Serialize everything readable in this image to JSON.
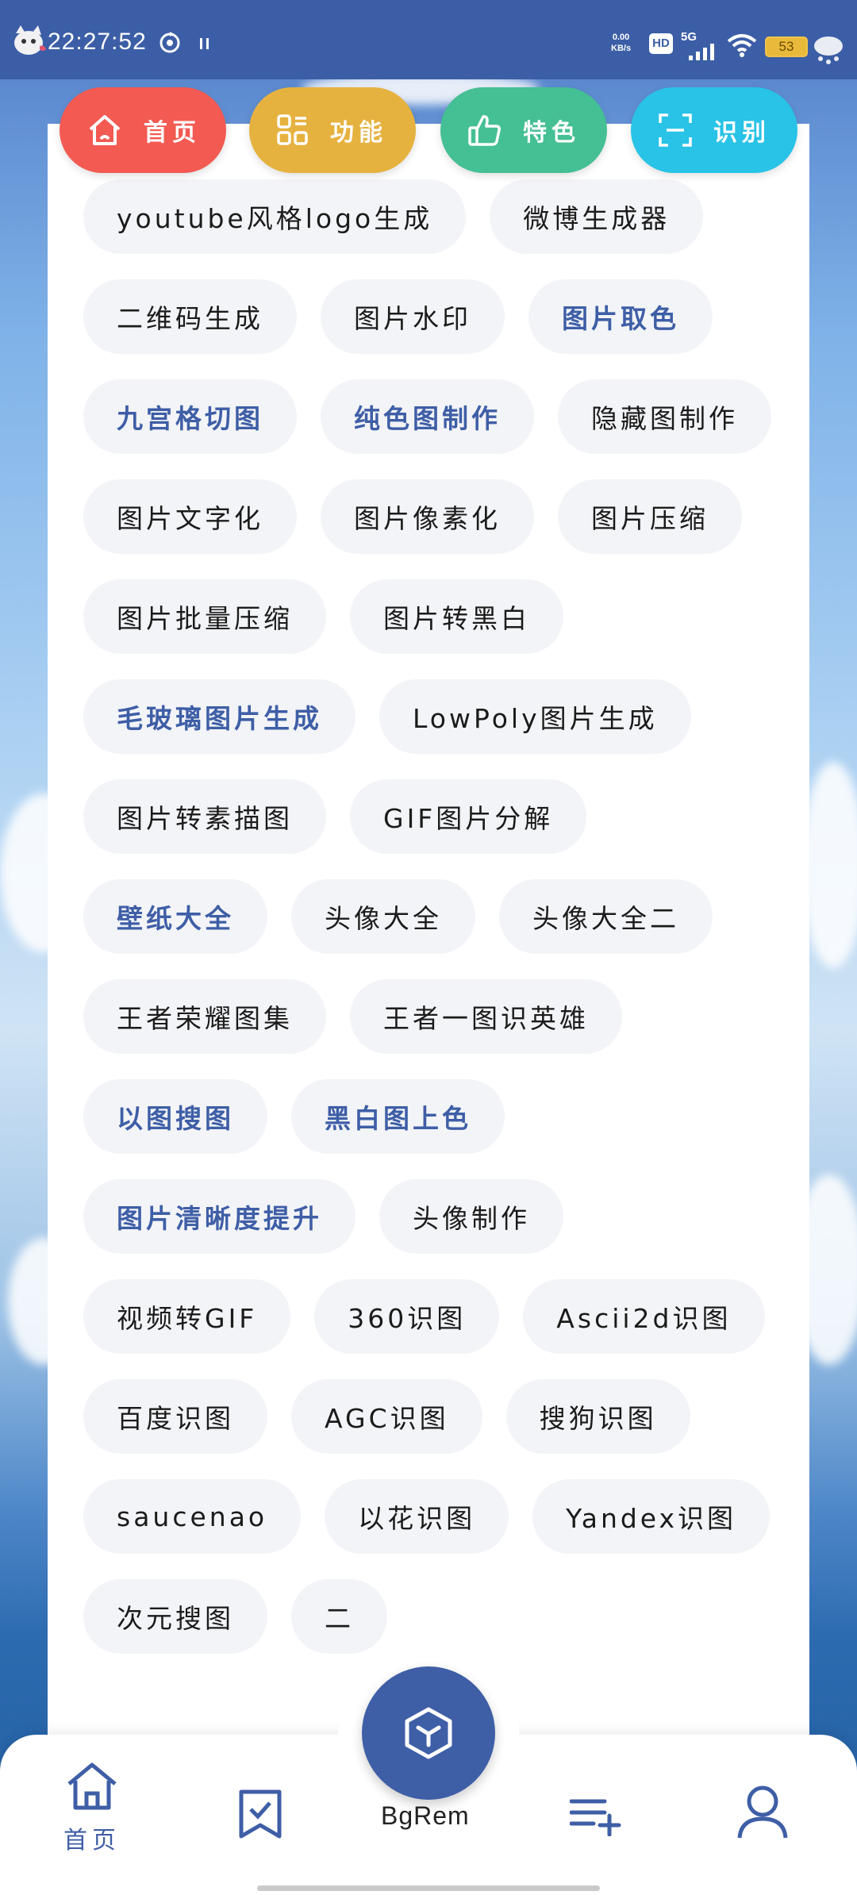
{
  "status_bar": {
    "time": "22:27:52",
    "net_speed_value": "0.00",
    "net_speed_unit": "KB/s",
    "hd_label": "HD",
    "network_label": "5G",
    "battery": "53"
  },
  "top_nav": [
    {
      "label": "首页",
      "icon": "home-icon",
      "color": "#f25a52"
    },
    {
      "label": "功能",
      "icon": "apps-icon",
      "color": "#e6b23f"
    },
    {
      "label": "特色",
      "icon": "thumbs-up-icon",
      "color": "#45bf94"
    },
    {
      "label": "识别",
      "icon": "scan-icon",
      "color": "#28c3e6"
    }
  ],
  "tools": [
    {
      "label": "youtube风格logo生成",
      "hot": false
    },
    {
      "label": "微博生成器",
      "hot": false
    },
    {
      "label": "二维码生成",
      "hot": false
    },
    {
      "label": "图片水印",
      "hot": false
    },
    {
      "label": "图片取色",
      "hot": true
    },
    {
      "label": "九宫格切图",
      "hot": true
    },
    {
      "label": "纯色图制作",
      "hot": true
    },
    {
      "label": "隐藏图制作",
      "hot": false
    },
    {
      "label": "图片文字化",
      "hot": false
    },
    {
      "label": "图片像素化",
      "hot": false
    },
    {
      "label": "图片压缩",
      "hot": false
    },
    {
      "label": "图片批量压缩",
      "hot": false
    },
    {
      "label": "图片转黑白",
      "hot": false
    },
    {
      "label": "毛玻璃图片生成",
      "hot": true
    },
    {
      "label": "LowPoly图片生成",
      "hot": false
    },
    {
      "label": "图片转素描图",
      "hot": false
    },
    {
      "label": "GIF图片分解",
      "hot": false
    },
    {
      "label": "壁纸大全",
      "hot": true
    },
    {
      "label": "头像大全",
      "hot": false
    },
    {
      "label": "头像大全二",
      "hot": false
    },
    {
      "label": "王者荣耀图集",
      "hot": false
    },
    {
      "label": "王者一图识英雄",
      "hot": false
    },
    {
      "label": "以图搜图",
      "hot": true
    },
    {
      "label": "黑白图上色",
      "hot": true
    },
    {
      "label": "图片清晰度提升",
      "hot": true
    },
    {
      "label": "头像制作",
      "hot": false
    },
    {
      "label": "视频转GIF",
      "hot": false
    },
    {
      "label": "360识图",
      "hot": false
    },
    {
      "label": "Ascii2d识图",
      "hot": false
    },
    {
      "label": "百度识图",
      "hot": false
    },
    {
      "label": "AGC识图",
      "hot": false
    },
    {
      "label": "搜狗识图",
      "hot": false
    },
    {
      "label": "saucenao",
      "hot": false
    },
    {
      "label": "以花识图",
      "hot": false
    },
    {
      "label": "Yandex识图",
      "hot": false
    },
    {
      "label": "次元搜图",
      "hot": false
    },
    {
      "label": "二",
      "hot": false
    }
  ],
  "bottom_nav": {
    "home_label": "首页",
    "fab_label": "BgRem",
    "accent": "#3e5ea6"
  }
}
